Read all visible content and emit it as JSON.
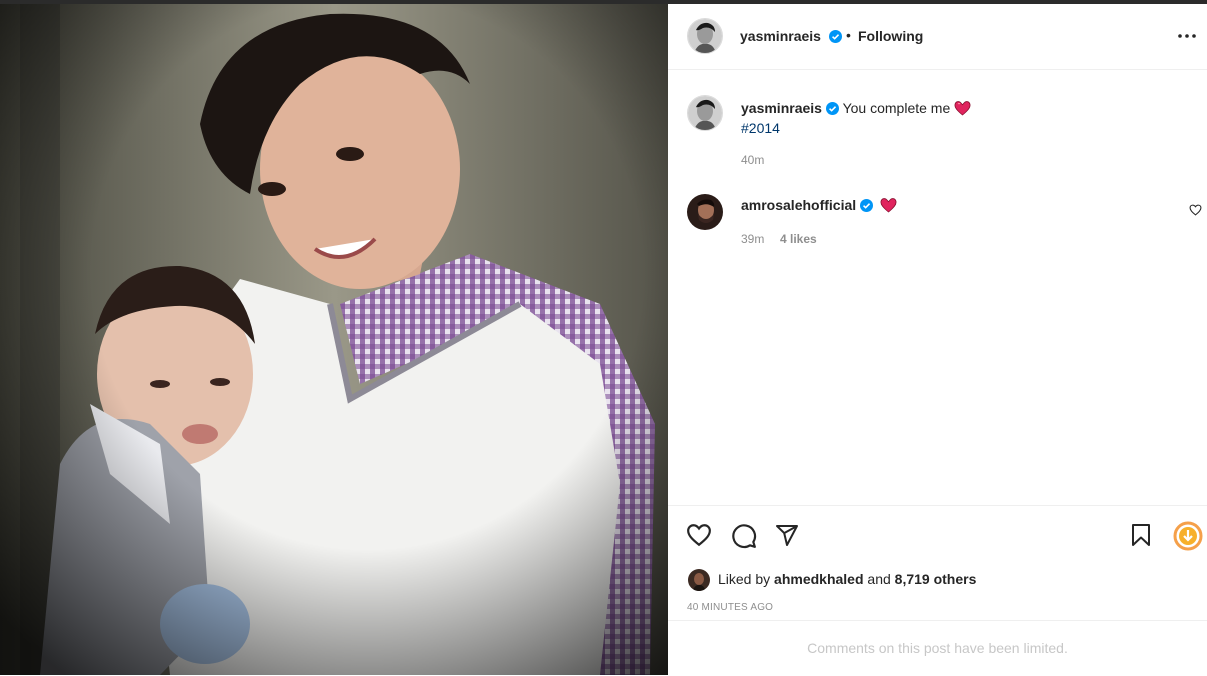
{
  "post": {
    "author": "yasminraeis",
    "follow_separator": "•",
    "follow_status": "Following",
    "caption_text": "You complete me",
    "caption_emoji": "heart",
    "hashtag": "#2014",
    "caption_time": "40m"
  },
  "comment": {
    "author": "amrosalehofficial",
    "emoji": "heart",
    "time": "39m",
    "likes": "4 likes"
  },
  "liked_by": {
    "prefix": "Liked by",
    "user": "ahmedkhaled",
    "conjunction": "and",
    "count": "8,719 others"
  },
  "timestamp": "40 MINUTES AGO",
  "comments_limited": "Comments on this post have been limited.",
  "colors": {
    "verified": "#0095f6",
    "heart_red": "#e0245e",
    "hashtag": "#00376b",
    "muted": "#8e8e8e"
  },
  "icons": [
    "more-icon",
    "heart-icon",
    "comment-icon",
    "share-icon",
    "bookmark-icon",
    "download-extension-icon",
    "verified-icon"
  ]
}
